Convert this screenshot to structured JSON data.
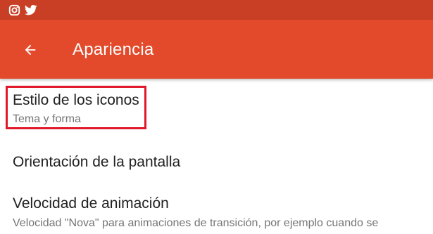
{
  "status_bar": {
    "icons": [
      "instagram-icon",
      "twitter-icon"
    ]
  },
  "app_bar": {
    "back_icon": "arrow-left-icon",
    "title": "Apariencia",
    "color": "#e24a2b",
    "status_color": "#c83f25"
  },
  "settings": {
    "items": [
      {
        "title": "Estilo de los iconos",
        "subtitle": "Tema y forma"
      },
      {
        "title": "Orientación de la pantalla",
        "subtitle": ""
      },
      {
        "title": "Velocidad de animación",
        "subtitle": "Velocidad \"Nova\" para animaciones de transición, por ejemplo cuando se"
      }
    ]
  },
  "highlight_color": "#e0192a"
}
